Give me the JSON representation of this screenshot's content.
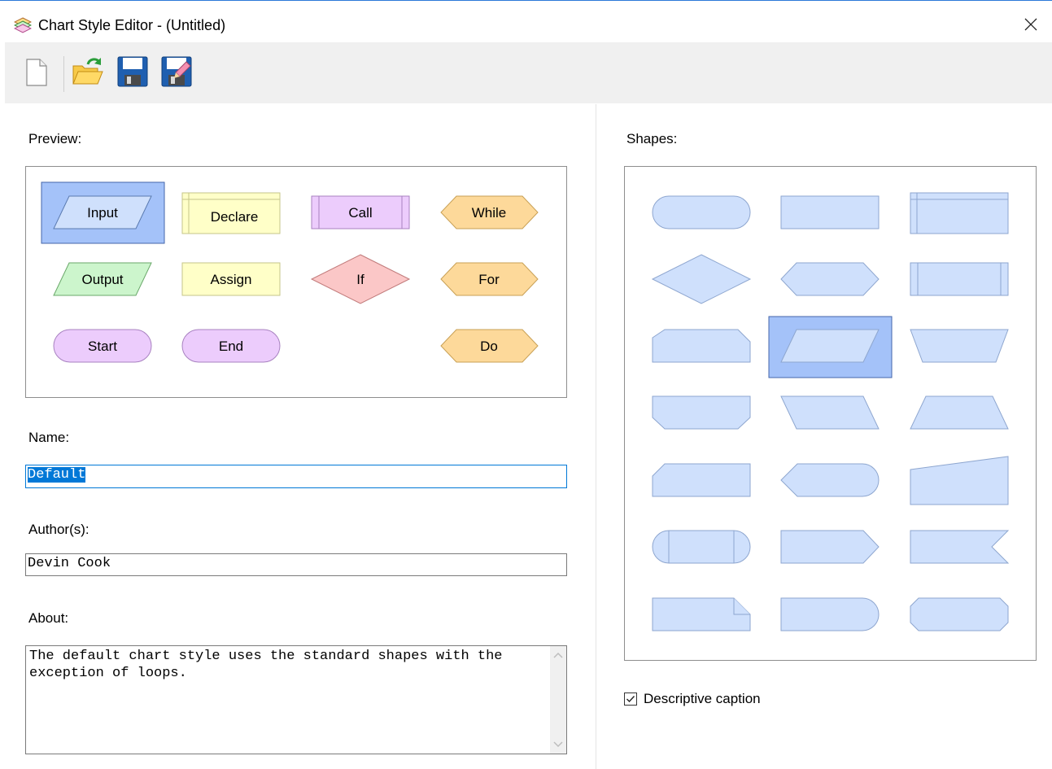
{
  "window": {
    "title": "Chart Style Editor - (Untitled)"
  },
  "toolbar": {
    "buttons": [
      {
        "name": "new",
        "icon": "new-document-icon"
      },
      {
        "name": "open",
        "icon": "open-folder-icon"
      },
      {
        "name": "save",
        "icon": "floppy-disk-icon"
      },
      {
        "name": "save-as",
        "icon": "floppy-disk-pencil-icon"
      }
    ]
  },
  "preview": {
    "label": "Preview:",
    "shapes": [
      {
        "text": "Input",
        "selected": true
      },
      {
        "text": "Declare"
      },
      {
        "text": "Call"
      },
      {
        "text": "While"
      },
      {
        "text": "Output"
      },
      {
        "text": "Assign"
      },
      {
        "text": "If"
      },
      {
        "text": "For"
      },
      {
        "text": "Start"
      },
      {
        "text": "End"
      },
      {
        "text": "Do"
      }
    ],
    "colors": {
      "selection": "#a4c2f9",
      "input": "#cfe0fc",
      "declare": "#ffffc8",
      "call": "#ecccfc",
      "loop": "#fdd99a",
      "output": "#ccf5cc",
      "if": "#fbc7c7",
      "terminal": "#ecccfc"
    }
  },
  "name": {
    "label": "Name:",
    "value": "Default"
  },
  "authors": {
    "label": "Author(s):",
    "value": "Devin Cook"
  },
  "about": {
    "label": "About:",
    "value": "The default chart style uses the standard shapes with the exception of loops."
  },
  "shapes": {
    "label": "Shapes:",
    "selected_index": 7,
    "fill": "#cfe0fc",
    "stroke": "#8ea6cf",
    "selection": "#a4c2f9"
  },
  "caption": {
    "label": "Descriptive caption",
    "checked": true
  }
}
